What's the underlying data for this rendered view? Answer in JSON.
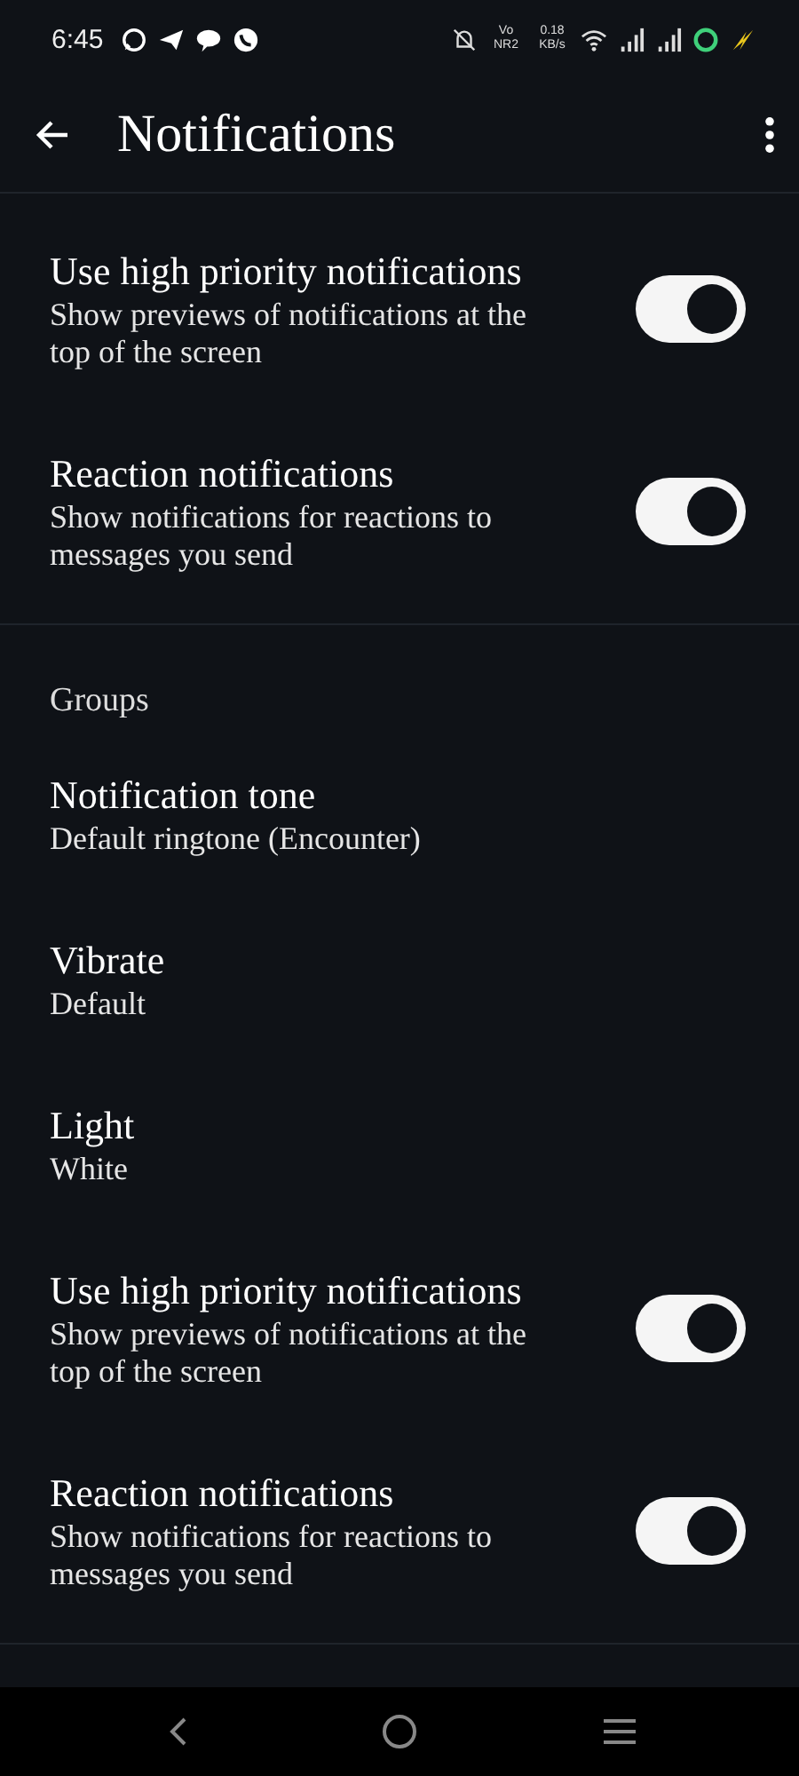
{
  "status_bar": {
    "time": "6:45",
    "network_label": "Vo NR2",
    "speed": "0.18 KB/s"
  },
  "app_bar": {
    "title": "Notifications"
  },
  "sections": [
    {
      "items": [
        {
          "kind": "switch",
          "title": "Use high priority notifications",
          "subtitle": "Show previews of notifications at the top of the screen",
          "on": true
        },
        {
          "kind": "switch",
          "title": "Reaction notifications",
          "subtitle": "Show notifications for reactions to messages you send",
          "on": true
        }
      ]
    },
    {
      "header": "Groups",
      "items": [
        {
          "kind": "text",
          "title": "Notification tone",
          "subtitle": "Default ringtone (Encounter)"
        },
        {
          "kind": "text",
          "title": "Vibrate",
          "subtitle": "Default"
        },
        {
          "kind": "text",
          "title": "Light",
          "subtitle": "White"
        },
        {
          "kind": "switch",
          "title": "Use high priority notifications",
          "subtitle": "Show previews of notifications at the top of the screen",
          "on": true
        },
        {
          "kind": "switch",
          "title": "Reaction notifications",
          "subtitle": "Show notifications for reactions to messages you send",
          "on": true
        }
      ]
    }
  ]
}
